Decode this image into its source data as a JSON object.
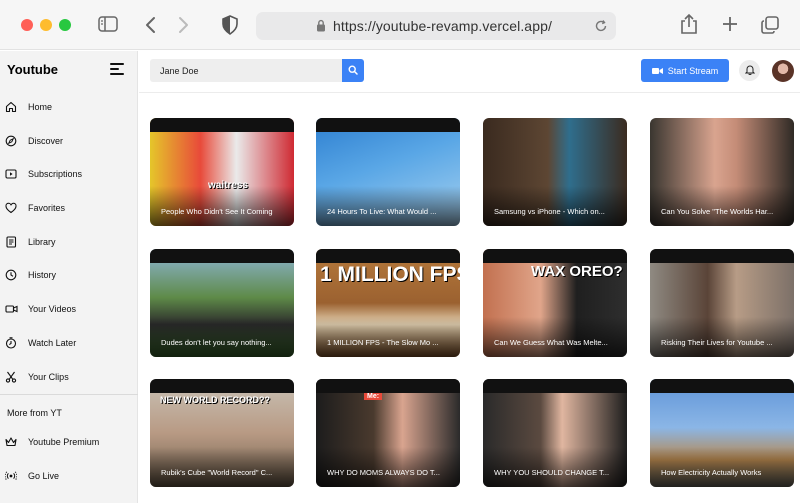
{
  "browser": {
    "url": "https://youtube-revamp.vercel.app/"
  },
  "sidebar": {
    "brand": "Youtube",
    "items": [
      {
        "label": "Home",
        "icon": "home-icon"
      },
      {
        "label": "Discover",
        "icon": "compass-icon"
      },
      {
        "label": "Subscriptions",
        "icon": "play-box-icon"
      },
      {
        "label": "Favorites",
        "icon": "heart-icon"
      },
      {
        "label": "Library",
        "icon": "library-icon"
      },
      {
        "label": "History",
        "icon": "history-icon"
      },
      {
        "label": "Your Videos",
        "icon": "video-camera-icon"
      },
      {
        "label": "Watch Later",
        "icon": "clock-icon"
      },
      {
        "label": "Your Clips",
        "icon": "scissors-icon"
      }
    ],
    "more_title": "More from YT",
    "more_items": [
      {
        "label": "Youtube Premium",
        "icon": "crown-icon"
      },
      {
        "label": "Go Live",
        "icon": "broadcast-icon"
      }
    ]
  },
  "header": {
    "search_value": "Jane Doe",
    "stream_label": "Start Stream"
  },
  "videos": [
    {
      "title": "People Who Didn't See It Coming",
      "overlay": "waitress"
    },
    {
      "title": "24 Hours To Live: What Would ..."
    },
    {
      "title": "Samsung vs iPhone - Which on..."
    },
    {
      "title": "Can You Solve \"The Worlds Har..."
    },
    {
      "title": "Dudes don't let you say nothing..."
    },
    {
      "title": "1 MILLION FPS - The Slow Mo ...",
      "overlay": "1 MILLION FPS"
    },
    {
      "title": "Can We Guess What Was Melte...",
      "overlay": "WAX OREO?"
    },
    {
      "title": "Risking Their Lives for Youtube ..."
    },
    {
      "title": "Rubik's Cube \"World Record\" C...",
      "overlay": "NEW WORLD RECORD??"
    },
    {
      "title": "WHY DO MOMS ALWAYS DO T...",
      "overlay": "Me:"
    },
    {
      "title": "WHY YOU SHOULD CHANGE T..."
    },
    {
      "title": "How Electricity Actually Works"
    }
  ],
  "colors": {
    "accent": "#3b82f6",
    "sidebar_bg": "#f3f3f3"
  }
}
